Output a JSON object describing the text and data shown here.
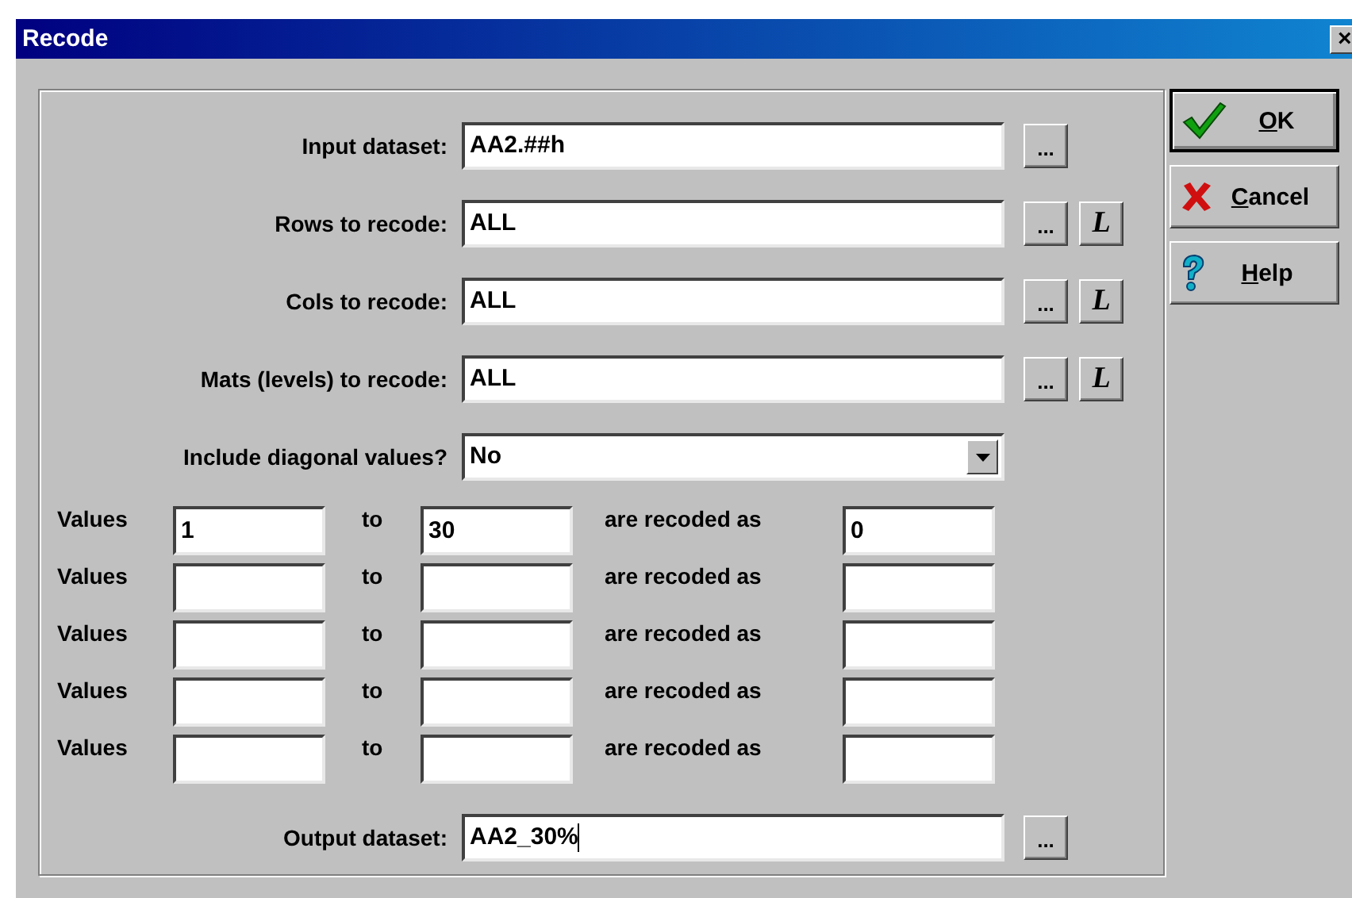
{
  "window": {
    "title": "Recode",
    "close": "×"
  },
  "fields": [
    {
      "label": "Input dataset:",
      "value": "AA2.##h",
      "buttons": [
        {
          "kind": "browse",
          "label": "..."
        }
      ]
    },
    {
      "label": "Rows to recode:",
      "value": "ALL",
      "buttons": [
        {
          "kind": "browse",
          "label": "..."
        },
        {
          "kind": "list",
          "label": "L"
        }
      ]
    },
    {
      "label": "Cols to recode:",
      "value": "ALL",
      "buttons": [
        {
          "kind": "browse",
          "label": "..."
        },
        {
          "kind": "list",
          "label": "L"
        }
      ]
    },
    {
      "label": "Mats (levels) to recode:",
      "value": "ALL",
      "buttons": [
        {
          "kind": "browse",
          "label": "..."
        },
        {
          "kind": "list",
          "label": "L"
        }
      ]
    }
  ],
  "diagonal": {
    "label": "Include diagonal values?",
    "value": "No"
  },
  "recode_rows": [
    {
      "label": "Values",
      "from": "1",
      "to_label": "to",
      "to": "30",
      "as_label": "are recoded as",
      "as": "0"
    },
    {
      "label": "Values",
      "to_label": "to",
      "as_label": "are recoded as"
    },
    {
      "label": "Values",
      "to_label": "to",
      "as_label": "are recoded as"
    },
    {
      "label": "Values",
      "to_label": "to",
      "as_label": "are recoded as"
    },
    {
      "label": "Values",
      "to_label": "to",
      "as_label": "are recoded as"
    }
  ],
  "output": {
    "label": "Output dataset:",
    "value": "AA2_30%",
    "focused": true,
    "buttons": [
      {
        "kind": "browse",
        "label": "..."
      }
    ]
  },
  "buttons": [
    {
      "kind": "ok",
      "label": "OK",
      "default": true
    },
    {
      "kind": "cancel",
      "label": "Cancel",
      "default": false
    },
    {
      "kind": "help",
      "label": "Help",
      "default": false
    }
  ]
}
